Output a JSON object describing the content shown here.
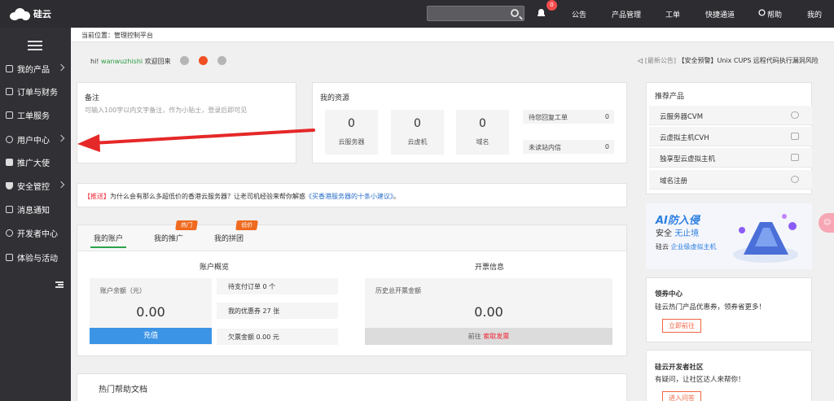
{
  "topbar": {
    "brand": "硅云",
    "notification_count": "0",
    "nav": [
      "公告",
      "产品管理",
      "工单",
      "快捷通道",
      "帮助",
      "我的"
    ]
  },
  "sidebar": {
    "items": [
      "我的产品",
      "订单与财务",
      "工单服务",
      "用户中心",
      "推广大使",
      "安全管控",
      "消息通知",
      "开发者中心",
      "体验与活动"
    ]
  },
  "breadcrumb": "当前位置：管理控制平台",
  "greeting": {
    "hi": "hi!",
    "user": "wanwuzhishi",
    "welcome": "欢迎回来"
  },
  "announcement": {
    "tag": "[最新公告]",
    "text": "【安全预警】Unix CUPS 远程代码执行漏洞风险"
  },
  "note": {
    "title": "备注",
    "placeholder": "可输入100字以内文字备注，作为小贴士，登录后即可见"
  },
  "resources": {
    "title": "我的资源",
    "counts": [
      {
        "value": "0",
        "label": "云服务器"
      },
      {
        "value": "0",
        "label": "云虚机"
      },
      {
        "value": "0",
        "label": "域名"
      }
    ],
    "rows": [
      {
        "label": "待您回复工单",
        "value": "0"
      },
      {
        "label": "未读站内信",
        "value": "0"
      }
    ]
  },
  "promo": {
    "tag": "【推送】",
    "text": "为什么会有那么多超低价的香港云服务器？让老司机经验来帮你解惑",
    "link": "《买香港服务器的十条小建议》",
    "end": "。"
  },
  "account": {
    "tabs": [
      "我的账户",
      "我的推广",
      "我的拼团"
    ],
    "badges": [
      "热门",
      "低价"
    ],
    "overview_title": "账户概览",
    "balance_label": "账户余额（元）",
    "balance": "0.00",
    "recharge": "充值",
    "stats": [
      "待支付订单 0 个",
      "我的优惠券 27 张",
      "欠票金额 0.00 元"
    ],
    "invoice_title": "开票信息",
    "invoice_label": "历史总开票金额",
    "invoice_amount": "0.00",
    "invoice_go": "前往",
    "invoice_link": "索取发票"
  },
  "help": {
    "title": "热门帮助文档"
  },
  "recommend": {
    "title": "推荐产品",
    "items": [
      "云服务器CVM",
      "云虚拟主机CVH",
      "独享型云虚拟主机",
      "域名注册"
    ]
  },
  "banner": {
    "line1": "AI防入侵",
    "line2a": "安全",
    "line2b": "无止境",
    "line3a": "硅云",
    "line3b": "企业级虚拟主机"
  },
  "coupon": {
    "title": "领券中心",
    "text": "硅云热门产品优惠券，领券省更多！",
    "button": "立即前往"
  },
  "community": {
    "title": "硅云开发者社区",
    "text": "有疑问，让社区达人来帮你！",
    "button": "进入问答"
  },
  "colors": {
    "accent": "#2aa34a",
    "primary": "#3c94e6",
    "alert": "#e52828",
    "hot": "#ef6a1f"
  }
}
